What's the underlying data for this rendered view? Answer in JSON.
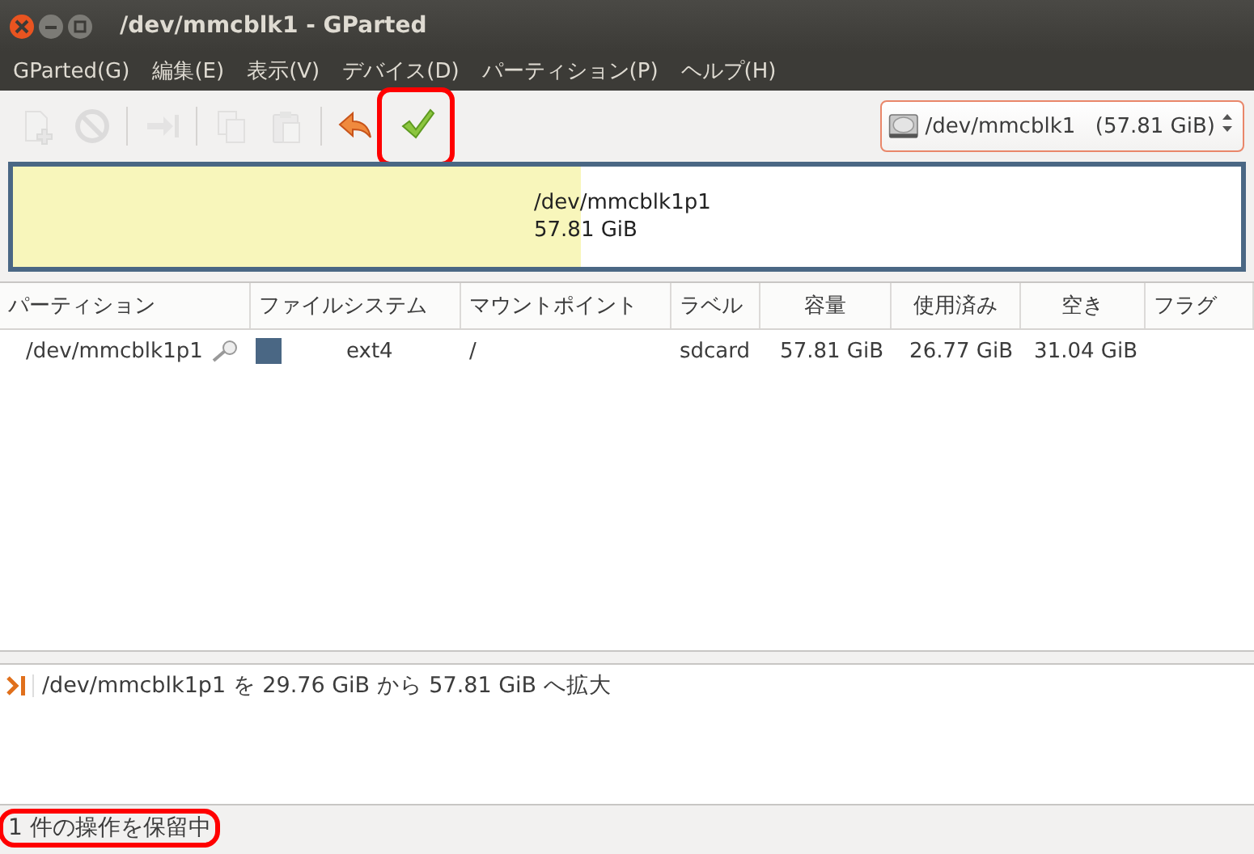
{
  "window": {
    "title": "/dev/mmcblk1 - GParted"
  },
  "menu": [
    "GParted(G)",
    "編集(E)",
    "表示(V)",
    "デバイス(D)",
    "パーティション(P)",
    "ヘルプ(H)"
  ],
  "toolbar": [
    {
      "kind": "new",
      "disabled": true,
      "highlighted": false
    },
    {
      "kind": "delete",
      "disabled": true,
      "highlighted": false
    },
    {
      "kind": "separator"
    },
    {
      "kind": "resize",
      "disabled": true,
      "highlighted": false
    },
    {
      "kind": "separator"
    },
    {
      "kind": "copy",
      "disabled": true,
      "highlighted": false
    },
    {
      "kind": "paste",
      "disabled": true,
      "highlighted": false
    },
    {
      "kind": "separator"
    },
    {
      "kind": "undo",
      "disabled": false,
      "highlighted": false
    },
    {
      "kind": "apply",
      "disabled": false,
      "highlighted": true
    }
  ],
  "device_selector": {
    "device": "/dev/mmcblk1",
    "size": "(57.81 GiB)"
  },
  "disk_map": {
    "partition": "/dev/mmcblk1p1",
    "size": "57.81 GiB",
    "level": 0.463
  },
  "table": {
    "columns": [
      "パーティション",
      "ファイルシステム",
      "マウントポイント",
      "ラベル",
      "容量",
      "使用済み",
      "空き",
      "フラグ"
    ],
    "rows": [
      {
        "partition": "/dev/mmcblk1p1",
        "mounted": true,
        "filesystem": "ext4",
        "color": "#4a6784",
        "mount_point": "/",
        "label": "sdcard",
        "size": "57.81 GiB",
        "used": "26.77 GiB",
        "free": "31.04 GiB"
      }
    ]
  },
  "operations": [
    {
      "text": "/dev/mmcblk1p1 を 29.76 GiB から 57.81 GiB へ拡大"
    }
  ],
  "status_bar": {
    "text": "1 件の操作を保留中",
    "highlighted": true
  }
}
